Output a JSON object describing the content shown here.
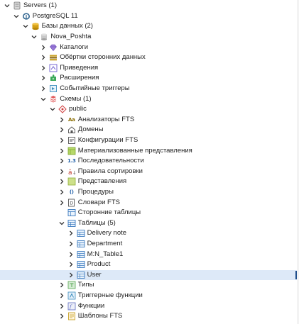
{
  "tree": [
    {
      "label": "Servers (1)",
      "level": 0,
      "expanded": true,
      "icon": "servers-icon"
    },
    {
      "label": "PostgreSQL 11",
      "level": 1,
      "expanded": true,
      "icon": "postgres-elephant-icon"
    },
    {
      "label": "Базы данных (2)",
      "level": 2,
      "expanded": true,
      "icon": "databases-icon"
    },
    {
      "label": "Nova_Poshta",
      "level": 3,
      "expanded": true,
      "icon": "database-icon"
    },
    {
      "label": "Каталоги",
      "level": 4,
      "expanded": false,
      "icon": "catalogs-icon"
    },
    {
      "label": "Обёртки сторонних данных",
      "level": 4,
      "expanded": false,
      "icon": "foreign-data-wrappers-icon"
    },
    {
      "label": "Приведения",
      "level": 4,
      "expanded": false,
      "icon": "casts-icon"
    },
    {
      "label": "Расширения",
      "level": 4,
      "expanded": false,
      "icon": "extensions-icon"
    },
    {
      "label": "Событийные триггеры",
      "level": 4,
      "expanded": false,
      "icon": "event-triggers-icon"
    },
    {
      "label": "Схемы (1)",
      "level": 4,
      "expanded": true,
      "icon": "schemas-icon"
    },
    {
      "label": "public",
      "level": 5,
      "expanded": true,
      "icon": "schema-icon"
    },
    {
      "label": "Анализаторы FTS",
      "level": 6,
      "expanded": false,
      "icon": "fts-parsers-icon",
      "icon_text": "Aa"
    },
    {
      "label": "Домены",
      "level": 6,
      "expanded": false,
      "icon": "domains-icon"
    },
    {
      "label": "Конфигурации FTS",
      "level": 6,
      "expanded": false,
      "icon": "fts-configurations-icon"
    },
    {
      "label": "Материализованные представления",
      "level": 6,
      "expanded": false,
      "icon": "materialized-views-icon"
    },
    {
      "label": "Последовательности",
      "level": 6,
      "expanded": false,
      "icon": "sequences-icon",
      "icon_text": "1.3"
    },
    {
      "label": "Правила сортировки",
      "level": 6,
      "expanded": false,
      "icon": "collations-icon"
    },
    {
      "label": "Представления",
      "level": 6,
      "expanded": false,
      "icon": "views-icon"
    },
    {
      "label": "Процедуры",
      "level": 6,
      "expanded": false,
      "icon": "procedures-icon",
      "icon_text": "()"
    },
    {
      "label": "Словари FTS",
      "level": 6,
      "expanded": false,
      "icon": "fts-dictionaries-icon"
    },
    {
      "label": "Сторонние таблицы",
      "level": 6,
      "expanded": null,
      "icon": "foreign-tables-icon"
    },
    {
      "label": "Таблицы (5)",
      "level": 6,
      "expanded": true,
      "icon": "tables-icon"
    },
    {
      "label": "Delivery note",
      "level": 7,
      "expanded": false,
      "icon": "table-icon"
    },
    {
      "label": "Department",
      "level": 7,
      "expanded": false,
      "icon": "table-icon"
    },
    {
      "label": "M:N_Table1",
      "level": 7,
      "expanded": false,
      "icon": "table-icon"
    },
    {
      "label": "Product",
      "level": 7,
      "expanded": false,
      "icon": "table-icon"
    },
    {
      "label": "User",
      "level": 7,
      "expanded": false,
      "icon": "table-icon",
      "selected": true
    },
    {
      "label": "Типы",
      "level": 6,
      "expanded": false,
      "icon": "types-icon"
    },
    {
      "label": "Триггерные функции",
      "level": 6,
      "expanded": false,
      "icon": "trigger-functions-icon"
    },
    {
      "label": "Функции",
      "level": 6,
      "expanded": false,
      "icon": "functions-icon"
    },
    {
      "label": "Шаблоны FTS",
      "level": 6,
      "expanded": false,
      "icon": "fts-templates-icon"
    }
  ]
}
